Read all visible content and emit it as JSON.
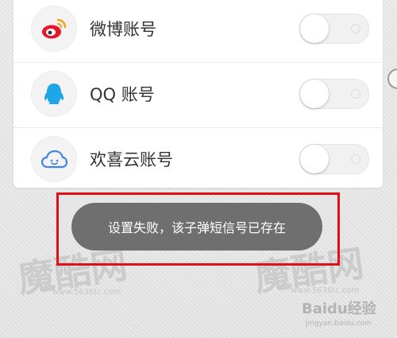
{
  "accounts": [
    {
      "label": "微博账号",
      "icon": "weibo-icon",
      "color": "#e6162d",
      "enabled": false
    },
    {
      "label": "QQ 账号",
      "icon": "qq-icon",
      "color": "#1ea5e8",
      "enabled": false
    },
    {
      "label": "欢喜云账号",
      "icon": "cloud-icon",
      "color": "#3f86e6",
      "enabled": false
    }
  ],
  "toast": {
    "message": "设置失败，该子弹短信号已存在"
  },
  "watermark": {
    "text": "魔酷网",
    "url": "www.5636tc.com",
    "baidu": "Baidu经验",
    "baidu_url": "jingyan.baidu.com"
  },
  "colors": {
    "highlight_border": "#e0101a",
    "toast_bg": "#6f6f6f"
  }
}
